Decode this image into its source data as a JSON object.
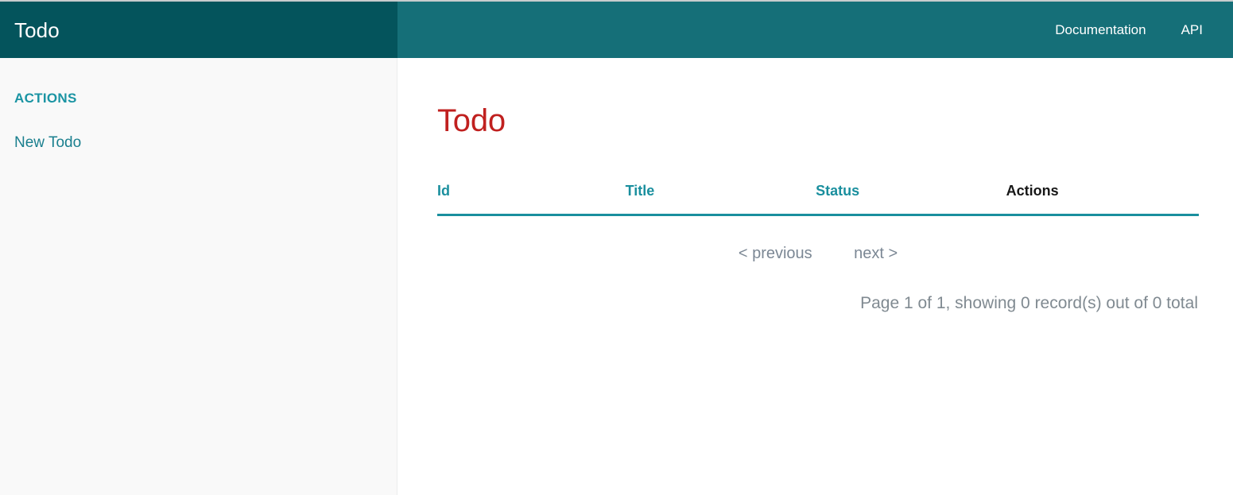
{
  "navbar": {
    "brand": "Todo",
    "links": [
      {
        "label": "Documentation",
        "name": "nav-link-documentation"
      },
      {
        "label": "API",
        "name": "nav-link-api"
      }
    ]
  },
  "sidebar": {
    "heading": "ACTIONS",
    "items": [
      {
        "label": "New Todo",
        "name": "sidebar-link-new-todo"
      }
    ]
  },
  "main": {
    "title": "Todo",
    "table": {
      "columns": [
        {
          "label": "Id",
          "sortable": true
        },
        {
          "label": "Title",
          "sortable": true
        },
        {
          "label": "Status",
          "sortable": true
        },
        {
          "label": "Actions",
          "sortable": false
        }
      ],
      "rows": []
    },
    "pagination": {
      "previous_label": "< previous",
      "next_label": "next >",
      "summary": "Page 1 of 1, showing 0 record(s) out of 0 total"
    }
  },
  "colors": {
    "brand_dark_teal": "#04545c",
    "navbar_teal": "#156f78",
    "link_teal": "#1a8f9e",
    "title_red": "#c0201f",
    "muted_grey": "#808a91",
    "sidebar_bg": "#f9f9f9"
  }
}
